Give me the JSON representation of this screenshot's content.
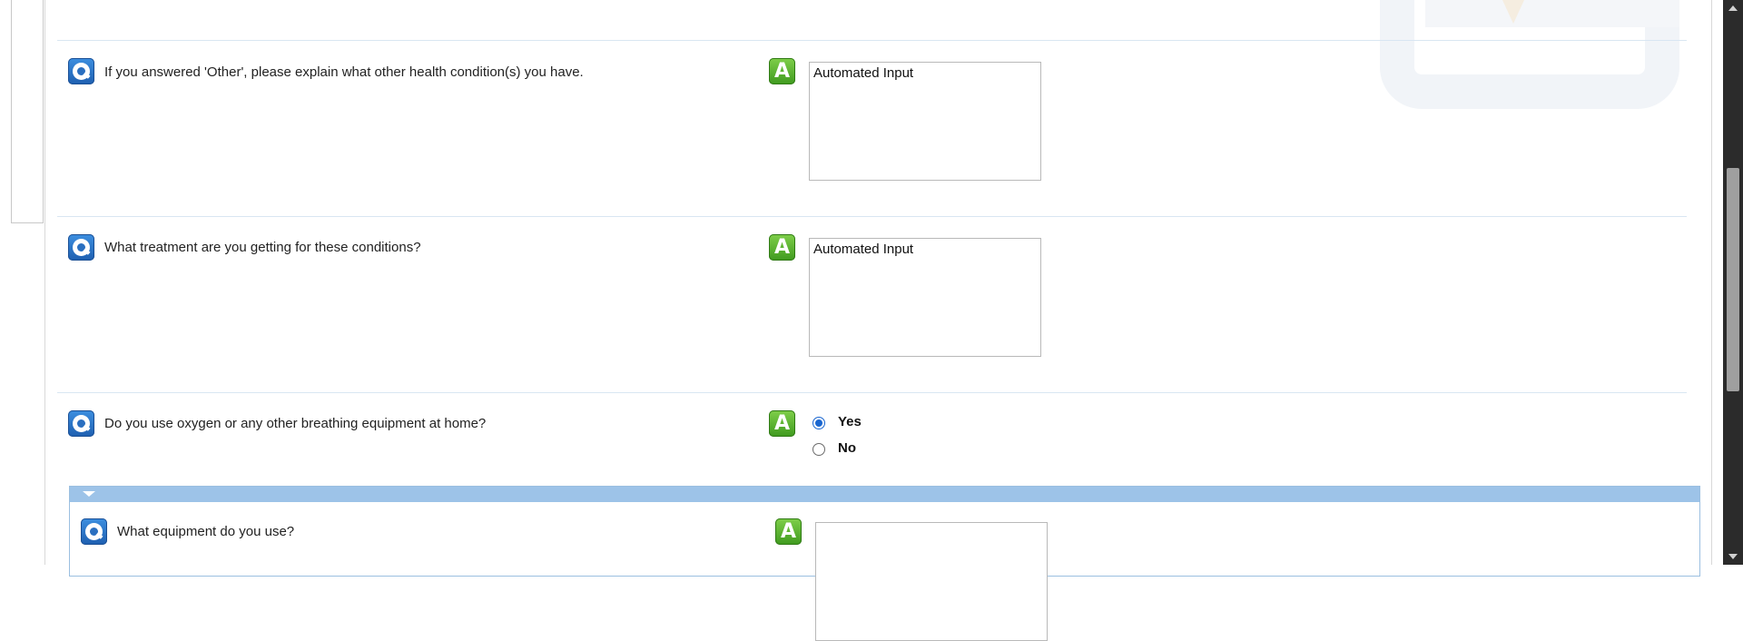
{
  "questions": [
    {
      "text": "If you answered 'Other', please explain what other health condition(s) you have.",
      "answer": "Automated Input"
    },
    {
      "text": "What treatment are you getting for these conditions?",
      "answer": "Automated Input"
    },
    {
      "text": "Do you use oxygen or any other breathing equipment at home?",
      "options": [
        "Yes",
        "No"
      ],
      "selected": "Yes"
    }
  ],
  "subsection": {
    "question": {
      "text": "What equipment do you use?",
      "answer": ""
    }
  },
  "icons": {
    "question": "question-icon",
    "answer": "answer-icon"
  },
  "icon_letters": {
    "answer": "A"
  },
  "colors": {
    "question_icon": "#2a6fc0",
    "answer_icon": "#4fae2a",
    "subsection_header": "#9dc3e8",
    "radio_selected": "#1a66d0"
  }
}
